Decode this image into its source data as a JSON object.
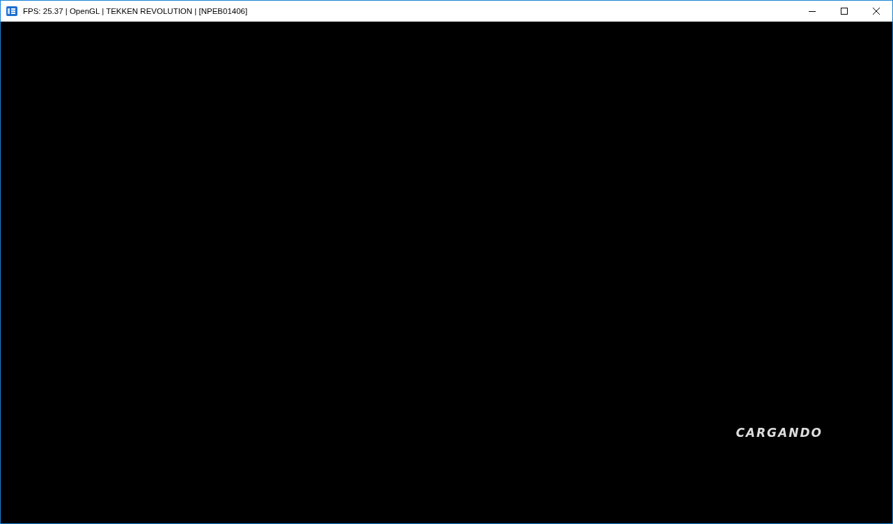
{
  "window": {
    "title": "FPS: 25.37 | OpenGL | TEKKEN REVOLUTION | [NPEB01406]"
  },
  "game_screen": {
    "loading_text": "CARGANDO"
  }
}
